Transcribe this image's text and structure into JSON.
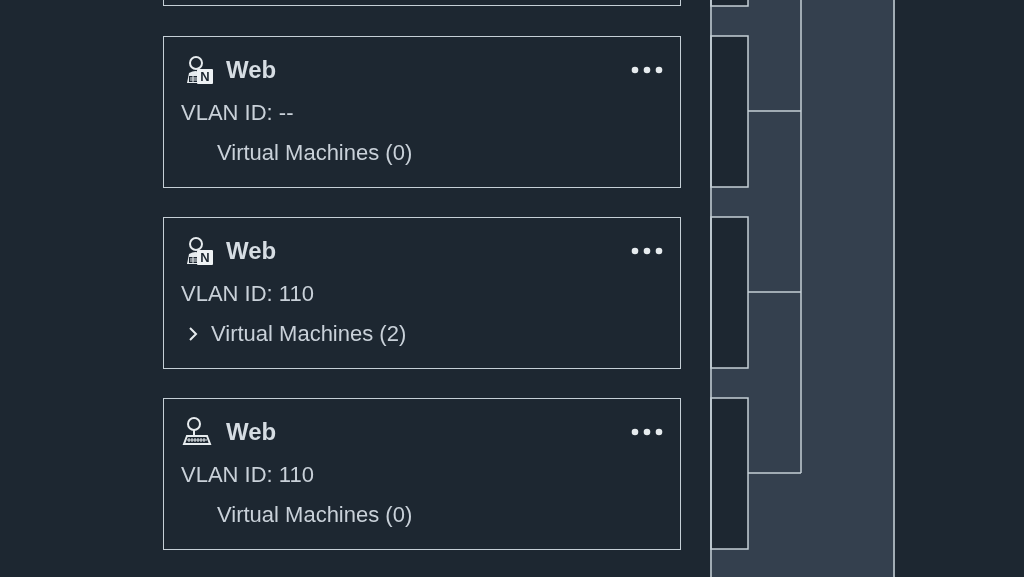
{
  "cards": [
    {
      "kind": "badge",
      "badge": "N",
      "title": "Web",
      "vlan": "VLAN ID: --",
      "vms": "Virtual Machines (0)",
      "expandable": false
    },
    {
      "kind": "badge",
      "badge": "N",
      "title": "Web",
      "vlan": "VLAN ID: 110",
      "vms": "Virtual Machines (2)",
      "expandable": true
    },
    {
      "kind": "plain",
      "title": "Web",
      "vlan": "VLAN ID: 110",
      "vms": "Virtual Machines (0)",
      "expandable": false
    }
  ]
}
